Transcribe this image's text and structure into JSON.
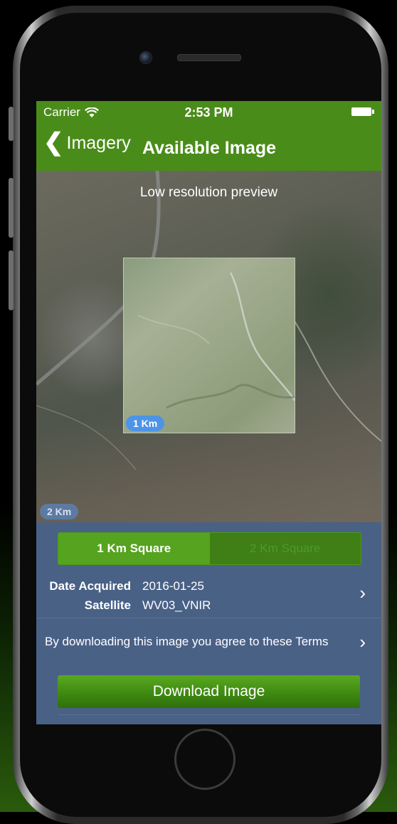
{
  "status_bar": {
    "carrier": "Carrier",
    "time": "2:53 PM"
  },
  "nav": {
    "back_label": "Imagery",
    "title": "Available Image"
  },
  "map": {
    "preview_text": "Low resolution preview",
    "inner_scale": "1 Km",
    "outer_scale": "2 Km"
  },
  "segment": {
    "options": [
      "1 Km Square",
      "2 Km Square"
    ],
    "selected": "1 Km Square"
  },
  "details": {
    "date_label": "Date Acquired",
    "date_value": "2016-01-25",
    "satellite_label": "Satellite",
    "satellite_value": "WV03_VNIR"
  },
  "terms_text": "By downloading this image you agree to these Terms",
  "download_label": "Download Image",
  "colors": {
    "nav_green": "#4a8c19",
    "panel_blue": "#4a6186",
    "badge_blue": "#4d94e8"
  }
}
